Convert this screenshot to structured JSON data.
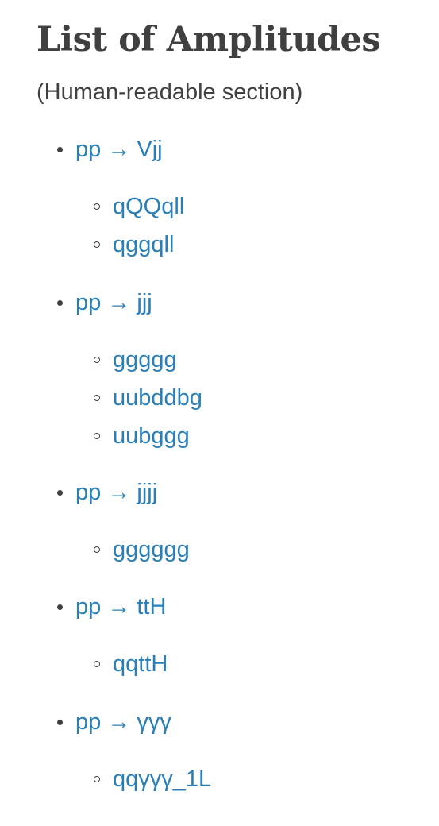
{
  "title": "List of Amplitudes",
  "subtitle": "(Human-readable section)",
  "processes": [
    {
      "label": "pp → Vjj",
      "amplitudes": [
        "qQQqll",
        "qggqll"
      ]
    },
    {
      "label": "pp → jjj",
      "amplitudes": [
        "ggggg",
        "uubddbg",
        "uubggg"
      ]
    },
    {
      "label": "pp → jjjj",
      "amplitudes": [
        "gggggg"
      ]
    },
    {
      "label": "pp → ttH",
      "amplitudes": [
        "qqttH"
      ]
    },
    {
      "label": "pp → γγγ",
      "amplitudes": [
        "qqγγγ_1L"
      ]
    }
  ]
}
